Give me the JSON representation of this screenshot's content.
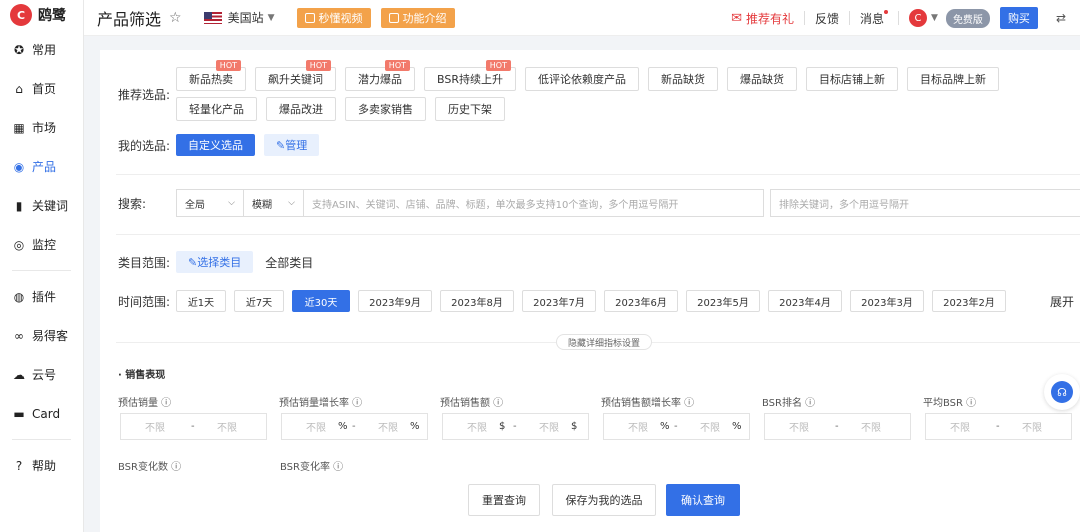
{
  "brand": {
    "logo_letter": "C",
    "name": "鸥鹭",
    "color": "#e4393c"
  },
  "sidebar": {
    "items": [
      {
        "label": "常用",
        "icon": "star-circle-icon",
        "glyph": "✪"
      },
      {
        "label": "首页",
        "icon": "home-icon",
        "glyph": "⌂"
      },
      {
        "label": "市场",
        "icon": "grid-icon",
        "glyph": "▦"
      },
      {
        "label": "产品",
        "icon": "eye-icon",
        "glyph": "◉"
      },
      {
        "label": "关键词",
        "icon": "bar-chart-icon",
        "glyph": "▮"
      },
      {
        "label": "监控",
        "icon": "webcam-icon",
        "glyph": "◎"
      },
      {
        "label": "插件",
        "icon": "chrome-icon",
        "glyph": "◍"
      },
      {
        "label": "易得客",
        "icon": "link-icon",
        "glyph": "∞"
      },
      {
        "label": "云号",
        "icon": "cloud-icon",
        "glyph": "☁"
      },
      {
        "label": "Card",
        "icon": "card-icon",
        "glyph": "▬"
      },
      {
        "label": "帮助",
        "icon": "question-icon",
        "glyph": "?"
      }
    ],
    "active_index": 3
  },
  "topbar": {
    "title": "产品筛选",
    "site": "美国站",
    "video_btn": "秒懂视频",
    "intro_btn": "功能介绍",
    "gift": "推荐有礼",
    "feedback": "反馈",
    "messages": "消息",
    "plan": "免费版",
    "buy": "购买"
  },
  "recommended": {
    "label": "推荐选品:",
    "hot_tag": "HOT",
    "chips": [
      "新品热卖",
      "飙升关键词",
      "潜力爆品",
      "BSR持续上升",
      "低评论依赖度产品",
      "新品缺货",
      "爆品缺货",
      "目标店铺上新",
      "目标品牌上新",
      "轻量化产品",
      "爆品改进",
      "多卖家销售",
      "历史下架"
    ]
  },
  "mine": {
    "label": "我的选品:",
    "custom": "自定义选品",
    "manage": "管理"
  },
  "search": {
    "label": "搜索:",
    "scope": "全局",
    "mode": "模糊",
    "placeholder": "支持ASIN、关键词、店铺、品牌、标题，单次最多支持10个查询，多个用逗号隔开",
    "exclude_placeholder": "排除关键词，多个用逗号隔开"
  },
  "category": {
    "label": "类目范围:",
    "select": "选择类目",
    "all": "全部类目"
  },
  "time": {
    "label": "时间范围:",
    "options": [
      "近1天",
      "近7天",
      "近30天",
      "2023年9月",
      "2023年8月",
      "2023年7月",
      "2023年6月",
      "2023年5月",
      "2023年4月",
      "2023年3月",
      "2023年2月"
    ],
    "active_index": 2,
    "expand": "展开"
  },
  "toggle_label": "隐藏详细指标设置",
  "section": "· 销售表现",
  "metrics": [
    {
      "label": "预估销量",
      "unit": ""
    },
    {
      "label": "预估销量增长率",
      "unit": "%"
    },
    {
      "label": "预估销售额",
      "unit": "$"
    },
    {
      "label": "预估销售额增长率",
      "unit": "%"
    },
    {
      "label": "BSR排名",
      "unit": ""
    },
    {
      "label": "平均BSR",
      "unit": ""
    }
  ],
  "metrics_row2": [
    "BSR变化数",
    "BSR变化率"
  ],
  "range": {
    "placeholder": "不限",
    "sep": "-"
  },
  "footer": {
    "reset": "重置查询",
    "save": "保存为我的选品",
    "confirm": "确认查询"
  }
}
